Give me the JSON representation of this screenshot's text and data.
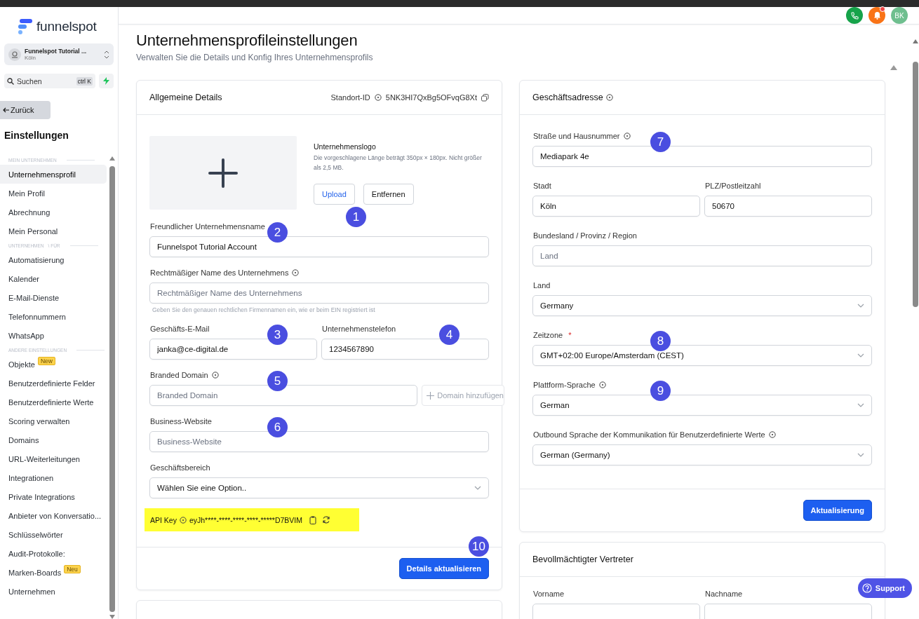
{
  "top_bar": {
    "avatar": "BK",
    "unread_notifications": true
  },
  "sidebar": {
    "brand": "funnelspot",
    "account": {
      "name": "Funnelspot Tutorial ...",
      "city": "Köln"
    },
    "search": {
      "placeholder": "Suchen",
      "shortcut": "ctrl K"
    },
    "back": "Zurück",
    "title": "Einstellungen",
    "sections": [
      {
        "title": "MEIN UNTERNEHMEN",
        "items": [
          {
            "label": "Unternehmensprofil",
            "selected": true
          },
          {
            "label": "Mein Profil",
            "selected": false
          },
          {
            "label": "Abrechnung",
            "selected": false
          },
          {
            "label": "Mein Personal",
            "selected": false
          }
        ]
      },
      {
        "title": "UNTERNEHMEN",
        "title_tail": "\\ FÜR",
        "items": [
          {
            "label": "Automatisierung",
            "selected": false
          },
          {
            "label": "Kalender",
            "selected": false
          },
          {
            "label": "E-Mail-Dienste",
            "selected": false
          },
          {
            "label": "Telefonnummern",
            "selected": false
          },
          {
            "label": "WhatsApp",
            "selected": false
          }
        ]
      },
      {
        "title": "ANDERE EINSTELLUNGEN",
        "items": [
          {
            "label": "Objekte",
            "badge": "New",
            "selected": false
          },
          {
            "label": "Benutzerdefinierte Felder",
            "selected": false
          },
          {
            "label": "Benutzerdefinierte Werte",
            "selected": false
          },
          {
            "label": "Scoring verwalten",
            "selected": false
          },
          {
            "label": "Domains",
            "selected": false
          },
          {
            "label": "URL-Weiterleitungen",
            "selected": false
          },
          {
            "label": "Integrationen",
            "selected": false
          },
          {
            "label": "Private Integrations",
            "selected": false
          },
          {
            "label": "Anbieter von Konversatio...",
            "selected": false
          },
          {
            "label": "Schlüsselwörter",
            "selected": false
          },
          {
            "label": "Audit-Protokolle:",
            "selected": false
          },
          {
            "label": "Marken-Boards",
            "badge": "Neu",
            "selected": false
          },
          {
            "label": "Unternehmen",
            "selected": false
          }
        ]
      }
    ]
  },
  "page": {
    "title": "Unternehmensprofileinstellungen",
    "subtitle": "Verwalten Sie die Details und Konfig Ihres Unternehmensprofils"
  },
  "general": {
    "title": "Allgemeine Details",
    "location_label": "Standort-ID",
    "location_id": "5NK3HI7QxBg5OFvqG8Xt",
    "logo": {
      "title": "Unternehmenslogo",
      "hint": "Die vorgeschlagene Länge beträgt 350px × 180px. Nicht größer als 2,5 MB.",
      "upload": "Upload",
      "remove": "Entfernen",
      "marker": "1"
    },
    "rows": [
      [
        {
          "label": "Freundlicher Unternehmensname",
          "kind": "text",
          "value": "Funnelspot Tutorial Account",
          "marker": "2"
        }
      ],
      [
        {
          "label": "Rechtmäßiger Name des Unternehmens",
          "info": true,
          "kind": "text",
          "placeholder": "Rechtmäßiger Name des Unternehmens",
          "hint": "Geben Sie den genauen rechtlichen Firmennamen ein, wie er beim EIN registriert ist"
        }
      ],
      [
        {
          "label": "Geschäfts-E-Mail",
          "kind": "text",
          "value": "janka@ce-digital.de",
          "marker": "3"
        },
        {
          "label": "Unternehmenstelefon",
          "kind": "text",
          "value": "1234567890",
          "marker": "4"
        }
      ],
      [
        {
          "label": "Branded Domain",
          "info": true,
          "kind": "text",
          "placeholder": "Branded Domain",
          "marker": "5",
          "action": {
            "label": "Domain hinzufügen",
            "disabled": true
          }
        }
      ],
      [
        {
          "label": "Business-Website",
          "kind": "text",
          "placeholder": "Business-Website",
          "marker": "6"
        }
      ],
      [
        {
          "label": "Geschäftsbereich",
          "kind": "select",
          "value": "Wählen Sie eine Option.."
        }
      ]
    ],
    "api_key": {
      "label": "API Key",
      "value": "eyJh****-****-****-****-*****D7BVIM",
      "highlighted": true
    },
    "submit": {
      "label": "Details aktualisieren",
      "marker": "10"
    }
  },
  "address": {
    "title": "Geschäftsadresse",
    "info": true,
    "rows": [
      [
        {
          "label": "Straße und Hausnummer",
          "info": true,
          "kind": "text",
          "value": "Mediapark 4e",
          "marker": "7"
        }
      ],
      [
        {
          "label": "Stadt",
          "kind": "text",
          "value": "Köln"
        },
        {
          "label": "PLZ/Postleitzahl",
          "kind": "text",
          "value": "50670"
        }
      ],
      [
        {
          "label": "Bundesland / Provinz / Region",
          "kind": "text",
          "placeholder": "Land"
        }
      ],
      [
        {
          "label": "Land",
          "kind": "select",
          "value": "Germany"
        }
      ],
      [
        {
          "label": "Zeitzone",
          "required_mark": "*",
          "kind": "select",
          "value": "GMT+02:00 Europe/Amsterdam (CEST)",
          "marker": "8"
        }
      ],
      [
        {
          "label": "Plattform-Sprache",
          "info": true,
          "kind": "select",
          "value": "German",
          "marker": "9"
        }
      ],
      [
        {
          "label": "Outbound Sprache der Kommunikation für Benutzerdefinierte Werte",
          "info": true,
          "kind": "select",
          "value": "German (Germany)"
        }
      ]
    ],
    "submit": {
      "label": "Aktualisierung"
    }
  },
  "representative": {
    "title": "Bevollmächtigter Vertreter",
    "fields": [
      {
        "label": "Vorname"
      },
      {
        "label": "Nachname"
      }
    ]
  },
  "support": {
    "label": "Support"
  }
}
